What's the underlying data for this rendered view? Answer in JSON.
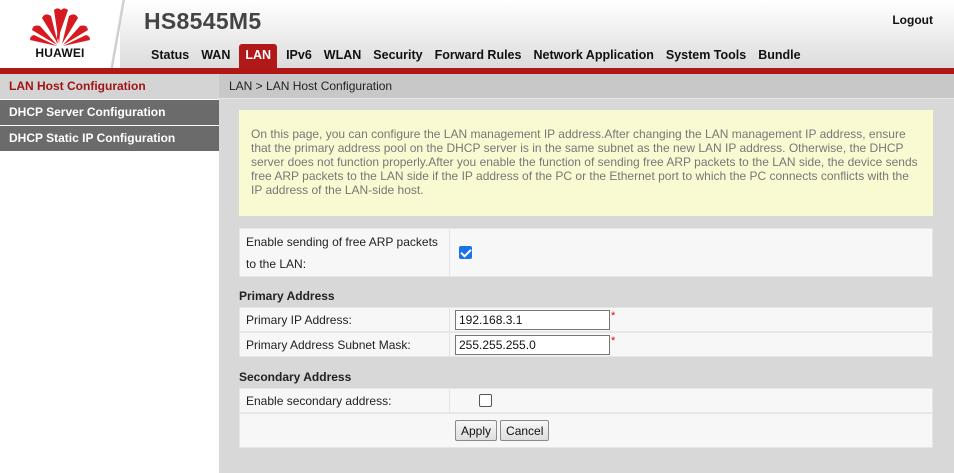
{
  "header": {
    "brand": "HUAWEI",
    "model": "HS8545M5",
    "logout_label": "Logout"
  },
  "nav": {
    "tabs": [
      {
        "label": "Status",
        "active": false
      },
      {
        "label": "WAN",
        "active": false
      },
      {
        "label": "LAN",
        "active": true
      },
      {
        "label": "IPv6",
        "active": false
      },
      {
        "label": "WLAN",
        "active": false
      },
      {
        "label": "Security",
        "active": false
      },
      {
        "label": "Forward Rules",
        "active": false
      },
      {
        "label": "Network Application",
        "active": false
      },
      {
        "label": "System Tools",
        "active": false
      },
      {
        "label": "Bundle",
        "active": false
      }
    ]
  },
  "sidebar": {
    "items": [
      {
        "label": "LAN Host Configuration",
        "active": true
      },
      {
        "label": "DHCP Server Configuration",
        "active": false
      },
      {
        "label": "DHCP Static IP Configuration",
        "active": false
      }
    ]
  },
  "breadcrumb": "LAN > LAN Host Configuration",
  "notice": "On this page, you can configure the LAN management IP address.After changing the LAN management IP address, ensure that the primary address pool on the DHCP server is in the same subnet as the new LAN IP address. Otherwise, the DHCP server does not function properly.After you enable the function of sending free ARP packets to the LAN side, the device sends free ARP packets to the LAN side if the IP address of the PC or the Ethernet port to which the PC connects conflicts with the IP address of the LAN-side host.",
  "arp": {
    "label": "Enable sending of free ARP packets to the LAN:",
    "checked": true
  },
  "primary": {
    "title": "Primary Address",
    "ip_label": "Primary IP Address:",
    "ip_value": "192.168.3.1",
    "mask_label": "Primary Address Subnet Mask:",
    "mask_value": "255.255.255.0",
    "required_mark": "*"
  },
  "secondary": {
    "title": "Secondary Address",
    "enable_label": "Enable secondary address:",
    "checked": false
  },
  "buttons": {
    "apply": "Apply",
    "cancel": "Cancel"
  },
  "colors": {
    "brand_red": "#b11818",
    "sidebar_gray": "#6b6b6b",
    "notice_bg": "#fafad2",
    "checkbox_blue": "#1a73e8"
  }
}
